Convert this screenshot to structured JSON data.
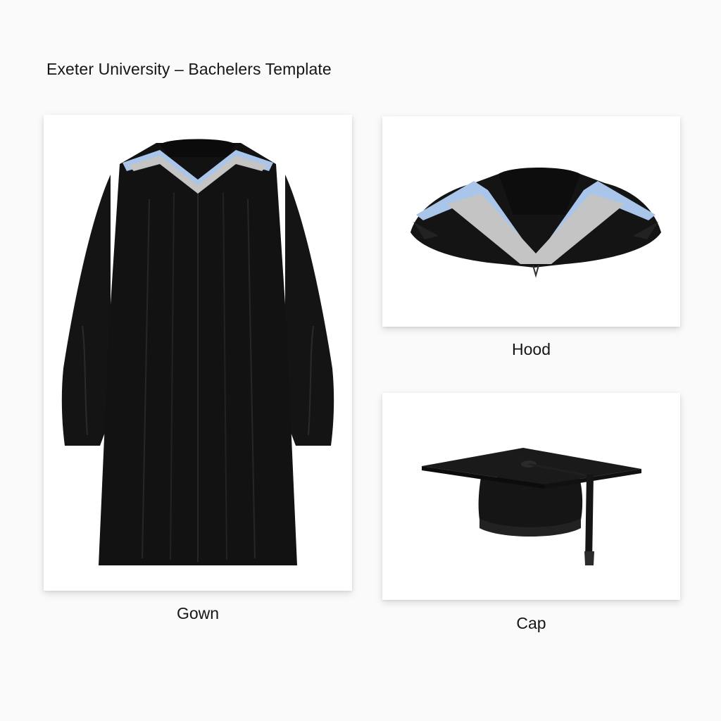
{
  "template": {
    "title": "Exeter University – Bachelers Template"
  },
  "items": {
    "gown": {
      "label": "Gown"
    },
    "hood": {
      "label": "Hood"
    },
    "cap": {
      "label": "Cap"
    }
  },
  "colors": {
    "fabric": "#141414",
    "hood_trim_blue": "#a9c6ea",
    "hood_lining_grey": "#c4c4c4",
    "page_background": "#fafafa"
  }
}
